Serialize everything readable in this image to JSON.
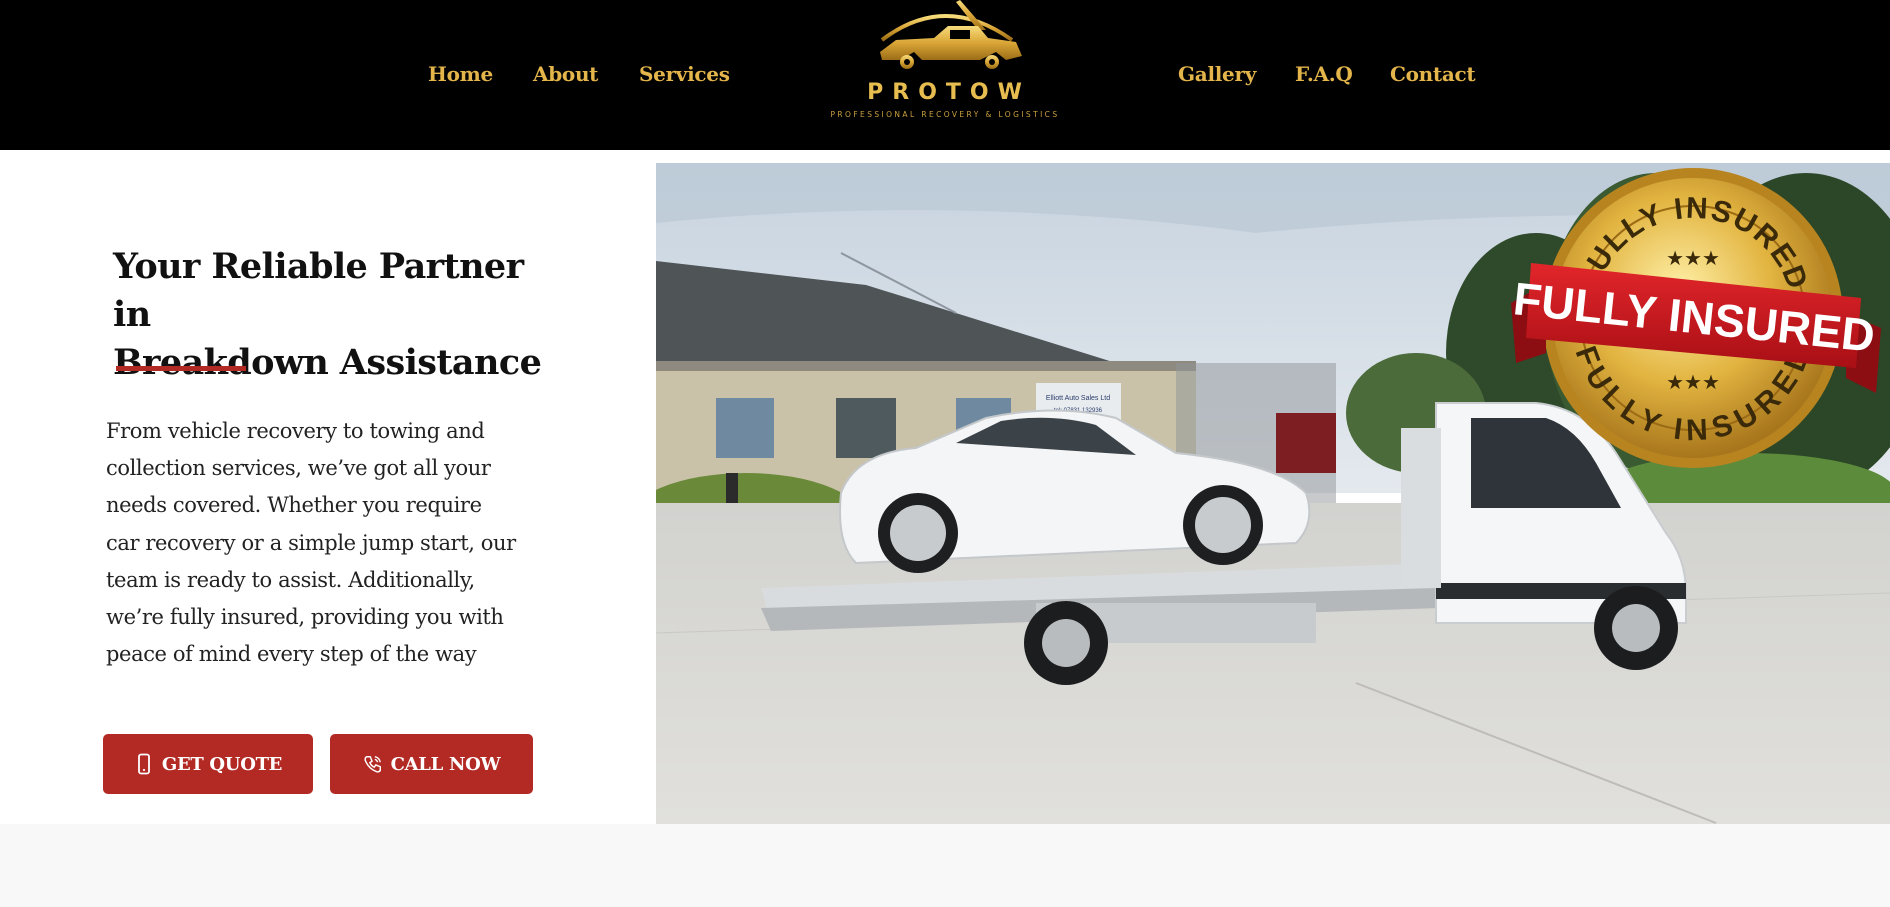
{
  "nav": {
    "left": [
      {
        "label": "Home"
      },
      {
        "label": "About"
      },
      {
        "label": "Services"
      }
    ],
    "right": [
      {
        "label": "Gallery"
      },
      {
        "label": "F.A.Q"
      },
      {
        "label": "Contact"
      }
    ]
  },
  "logo": {
    "word": "PROTOW",
    "tagline": "PROFESSIONAL RECOVERY & LOGISTICS",
    "icon": "tow-truck-logo-icon"
  },
  "hero": {
    "title_line1": "Your Reliable Partner in",
    "title_line2": "Breakdown Assistance",
    "body": "From vehicle recovery to towing and collection services, we’ve got all your needs covered. Whether you require car recovery or a simple jump start, our team is ready to assist. Additionally, we’re fully insured, providing you with peace of mind every step of the way",
    "buttons": {
      "quote_label": "GET QUOTE",
      "quote_icon": "mobile-phone-icon",
      "call_label": "CALL NOW",
      "call_icon": "phone-call-icon"
    },
    "photo": {
      "badge_top": "FULLY INSURED",
      "badge_center": "FULLY INSURED",
      "badge_bottom": "FULLY INSURED",
      "sign_line1": "Elliott Auto Sales Ltd",
      "sign_line2": "tel: 07831 132936"
    }
  },
  "colors": {
    "header_bg": "#000000",
    "gold": "#e3b54a",
    "accent_red": "#b32a25",
    "text": "#111111"
  }
}
